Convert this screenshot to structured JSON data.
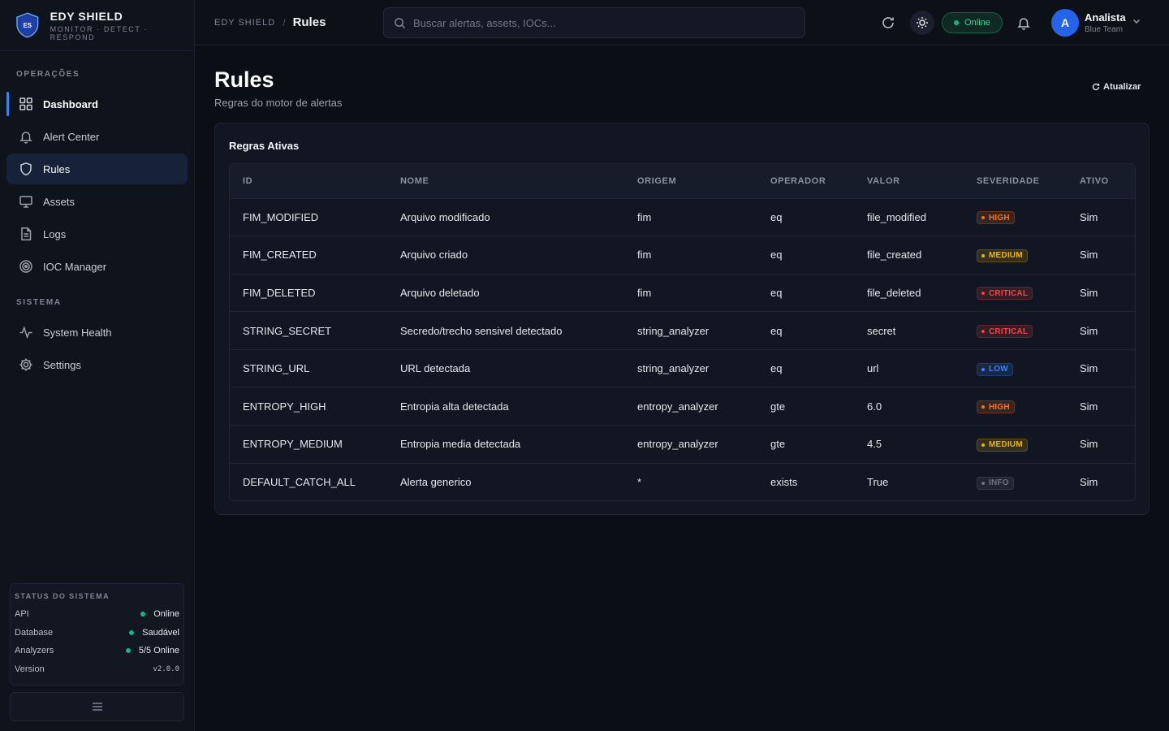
{
  "brand": {
    "logo_text": "ES",
    "name": "EDY SHIELD",
    "tagline": "MONITOR · DETECT · RESPOND"
  },
  "sidebar": {
    "sections": [
      {
        "title": "OPERAÇÕES"
      },
      {
        "title": "SISTEMA"
      }
    ],
    "items": [
      {
        "label": "Dashboard",
        "icon": "grid-icon"
      },
      {
        "label": "Alert Center",
        "icon": "bell-icon"
      },
      {
        "label": "Rules",
        "icon": "shield-icon"
      },
      {
        "label": "Assets",
        "icon": "monitor-icon"
      },
      {
        "label": "Logs",
        "icon": "file-icon"
      },
      {
        "label": "IOC Manager",
        "icon": "target-icon"
      },
      {
        "label": "System Health",
        "icon": "activity-icon"
      },
      {
        "label": "Settings",
        "icon": "gear-icon"
      }
    ],
    "status": {
      "title": "STATUS DO SISTEMA",
      "rows": [
        {
          "label": "API",
          "value": "Online"
        },
        {
          "label": "Database",
          "value": "Saudável"
        },
        {
          "label": "Analyzers",
          "value": "5/5 Online"
        },
        {
          "label": "Version",
          "value": "v2.0.0"
        }
      ]
    }
  },
  "header": {
    "breadcrumb_root": "EDY SHIELD",
    "breadcrumb_sep": "/",
    "breadcrumb_current": "Rules",
    "search_placeholder": "Buscar alertas, assets, IOCs...",
    "status": "Online",
    "user": {
      "initial": "A",
      "name": "Analista",
      "role": "Blue Team"
    }
  },
  "page": {
    "title": "Rules",
    "subtitle": "Regras do motor de alertas",
    "refresh_label": "Atualizar",
    "card_title": "Regras Ativas"
  },
  "colors": {
    "accent": "#3b82f6",
    "online": "#10b981",
    "high": "#f97316",
    "medium": "#eab308",
    "critical": "#ef4444",
    "low": "#3b82f6",
    "info": "#6b7280"
  },
  "table": {
    "columns": [
      "ID",
      "NOME",
      "ORIGEM",
      "OPERADOR",
      "VALOR",
      "SEVERIDADE",
      "ATIVO"
    ],
    "rows": [
      {
        "id": "FIM_MODIFIED",
        "nome": "Arquivo modificado",
        "origem": "fim",
        "operador": "eq",
        "valor": "file_modified",
        "severidade": "HIGH",
        "ativo": "Sim"
      },
      {
        "id": "FIM_CREATED",
        "nome": "Arquivo criado",
        "origem": "fim",
        "operador": "eq",
        "valor": "file_created",
        "severidade": "MEDIUM",
        "ativo": "Sim"
      },
      {
        "id": "FIM_DELETED",
        "nome": "Arquivo deletado",
        "origem": "fim",
        "operador": "eq",
        "valor": "file_deleted",
        "severidade": "CRITICAL",
        "ativo": "Sim"
      },
      {
        "id": "STRING_SECRET",
        "nome": "Secredo/trecho sensivel detectado",
        "origem": "string_analyzer",
        "operador": "eq",
        "valor": "secret",
        "severidade": "CRITICAL",
        "ativo": "Sim"
      },
      {
        "id": "STRING_URL",
        "nome": "URL detectada",
        "origem": "string_analyzer",
        "operador": "eq",
        "valor": "url",
        "severidade": "LOW",
        "ativo": "Sim"
      },
      {
        "id": "ENTROPY_HIGH",
        "nome": "Entropia alta detectada",
        "origem": "entropy_analyzer",
        "operador": "gte",
        "valor": "6.0",
        "severidade": "HIGH",
        "ativo": "Sim"
      },
      {
        "id": "ENTROPY_MEDIUM",
        "nome": "Entropia media detectada",
        "origem": "entropy_analyzer",
        "operador": "gte",
        "valor": "4.5",
        "severidade": "MEDIUM",
        "ativo": "Sim"
      },
      {
        "id": "DEFAULT_CATCH_ALL",
        "nome": "Alerta generico",
        "origem": "*",
        "operador": "exists",
        "valor": "True",
        "severidade": "INFO",
        "ativo": "Sim"
      }
    ]
  }
}
